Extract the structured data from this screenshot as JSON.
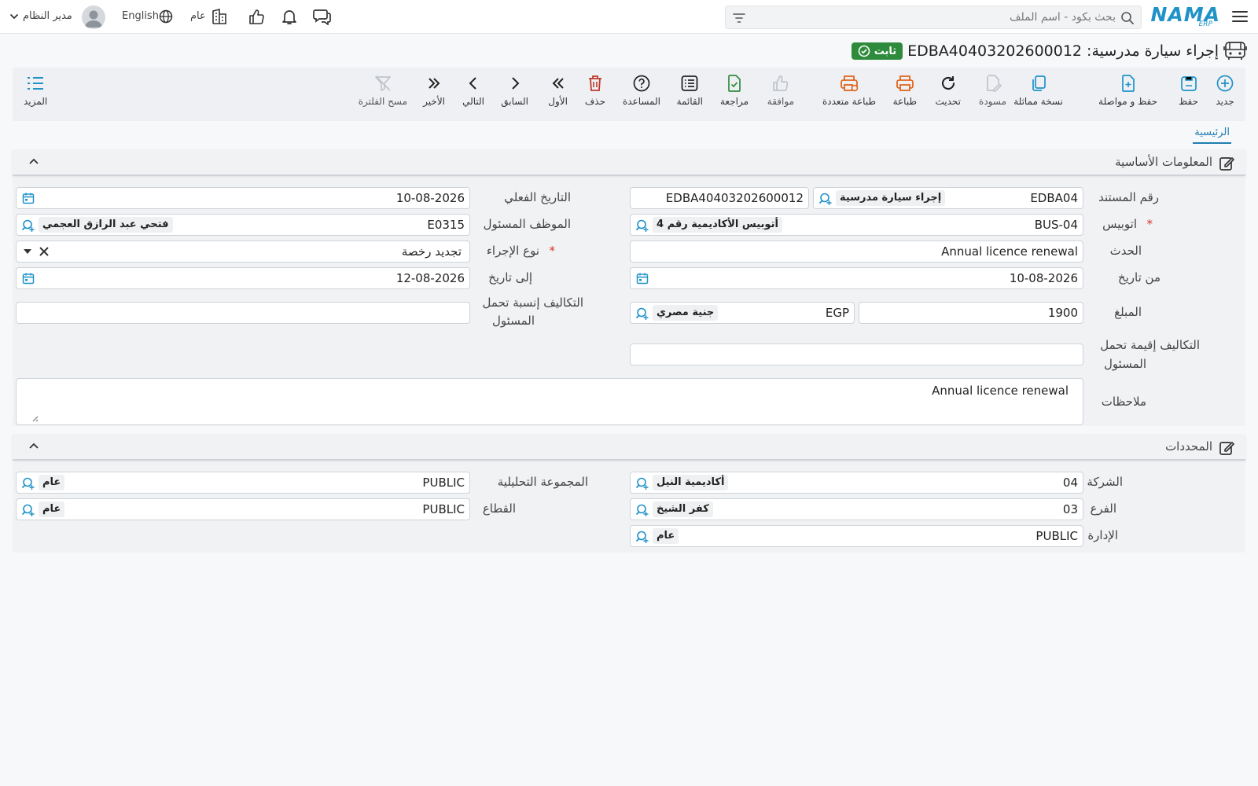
{
  "header": {
    "brand": "NAMA",
    "brand_sub": "ERP",
    "search_placeholder": "بحث بكود - اسم الملف",
    "scope_label": "عام",
    "language_label": "English",
    "user_name": "مدير النظام"
  },
  "title": {
    "text": "إجراء سيارة مدرسية: EDBA40403202600012",
    "status": "ثابت"
  },
  "toolbar": {
    "new": "جديد",
    "save": "حفظ",
    "save_continue": "حفظ و مواصلة",
    "duplicate": "نسخة مماثلة",
    "draft": "مسودة",
    "refresh": "تحديث",
    "print": "طباعة",
    "multi_print": "طباعة متعددة",
    "approve": "موافقة",
    "review": "مراجعة",
    "list": "القائمة",
    "help": "المساعدة",
    "delete": "حذف",
    "first": "الأول",
    "previous": "السابق",
    "next": "التالي",
    "last": "الأخير",
    "clear_filter": "مسح الفلترة",
    "more": "المزيد"
  },
  "tabs": {
    "main": "الرئيسية"
  },
  "basic": {
    "title": "المعلومات الأساسية",
    "doc_no_label": "رقم المستند",
    "doc_book_code": "EDBA04",
    "doc_book_name": "إجراء سيارة مدرسية",
    "doc_no_value": "EDBA40403202600012",
    "actual_date_label": "التاريخ الفعلي",
    "actual_date": "10-08-2026",
    "bus_label": "اتوبيس",
    "bus_code": "BUS-04",
    "bus_name": "أتوبيس الأكاديمية رقم 4",
    "employee_label": "الموظف المسئول",
    "employee_code": "E0315",
    "employee_name": "فتحي عبد الرازق العجمي",
    "event_label": "الحدث",
    "event_value": "Annual licence renewal",
    "action_type_label": "نوع الإجراء",
    "action_type_value": "تجديد رخصة",
    "from_date_label": "من تاريخ",
    "from_date": "10-08-2026",
    "to_date_label": "إلى تاريخ",
    "to_date": "12-08-2026",
    "amount_label": "المبلغ",
    "amount_value": "1900",
    "currency_code": "EGP",
    "currency_name": "جنية مصري",
    "cost_ratio_label_1": "التكاليف إنسبة تحمل",
    "cost_ratio_label_2": "المسئول",
    "cost_value_label_1": "التكاليف إقيمة تحمل",
    "cost_value_label_2": "المسئول",
    "notes_label": "ملاحظات",
    "notes_value": "Annual licence renewal"
  },
  "dimensions": {
    "title": "المحددات",
    "company_label": "الشركة",
    "company_code": "04",
    "company_name": "أكاديمية النيل",
    "analytic_label": "المجموعة التحليلية",
    "analytic_code": "PUBLIC",
    "analytic_name": "عام",
    "branch_label": "الفرع",
    "branch_code": "03",
    "branch_name": "كفر الشيخ",
    "sector_label": "القطاع",
    "sector_code": "PUBLIC",
    "sector_name": "عام",
    "dept_label": "الإدارة",
    "dept_code": "PUBLIC",
    "dept_name": "عام"
  },
  "colors": {
    "accent": "#1f92c8",
    "status_green": "#2e8b3c",
    "print_orange": "#e0641c",
    "delete_red": "#c0392b"
  }
}
